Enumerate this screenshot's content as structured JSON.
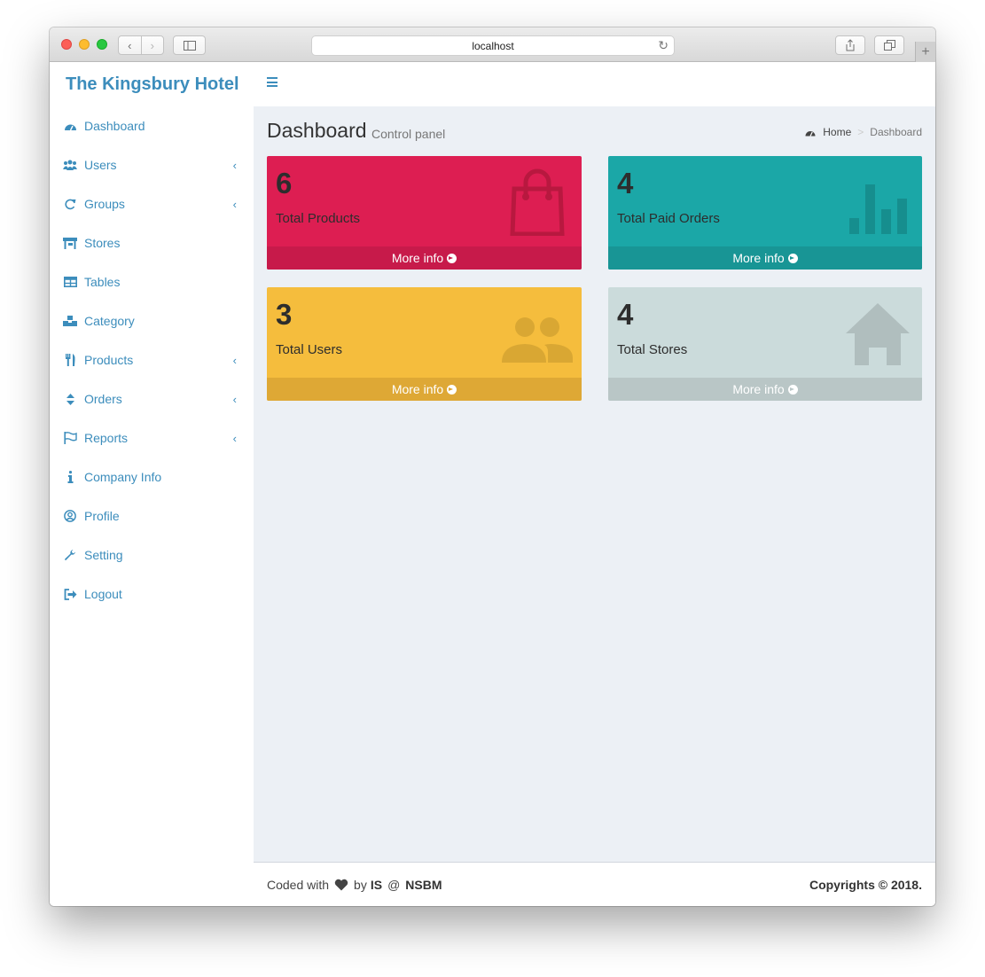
{
  "browser": {
    "url": "localhost"
  },
  "app": {
    "brand": "The Kingsbury Hotel"
  },
  "sidebar": {
    "items": [
      {
        "label": "Dashboard"
      },
      {
        "label": "Users"
      },
      {
        "label": "Groups"
      },
      {
        "label": "Stores"
      },
      {
        "label": "Tables"
      },
      {
        "label": "Category"
      },
      {
        "label": "Products"
      },
      {
        "label": "Orders"
      },
      {
        "label": "Reports"
      },
      {
        "label": "Company Info"
      },
      {
        "label": "Profile"
      },
      {
        "label": "Setting"
      },
      {
        "label": "Logout"
      }
    ]
  },
  "header": {
    "title": "Dashboard",
    "subtitle": "Control panel"
  },
  "breadcrumb": {
    "home": "Home",
    "current": "Dashboard"
  },
  "boxes": [
    {
      "value": "6",
      "label": "Total Products",
      "more": "More info",
      "color": "#dd1e52",
      "footer_color": "#c71a4a",
      "icon": "shopping-bag-icon"
    },
    {
      "value": "4",
      "label": "Total Paid Orders",
      "more": "More info",
      "color": "#1ba7a7",
      "footer_color": "#189595",
      "icon": "bar-chart-icon"
    },
    {
      "value": "3",
      "label": "Total Users",
      "more": "More info",
      "color": "#f5bd3d",
      "footer_color": "#dea835",
      "icon": "users-icon"
    },
    {
      "value": "4",
      "label": "Total Stores",
      "more": "More info",
      "color": "#cbdbdb",
      "footer_color": "#b9c6c6",
      "icon": "home-icon"
    }
  ],
  "footer": {
    "coded_with": "Coded with",
    "by": "by",
    "author": "IS",
    "at": "@",
    "org": "NSBM",
    "copyright": "Copyrights © 2018."
  }
}
